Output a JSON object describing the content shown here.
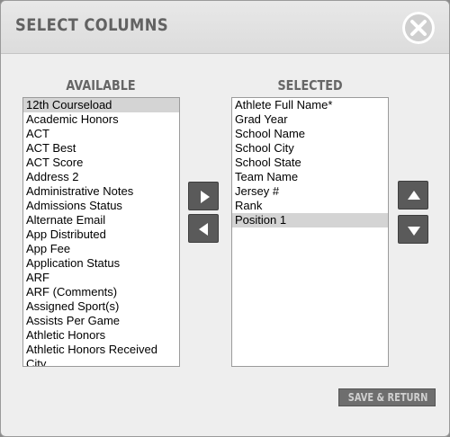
{
  "dialog": {
    "title": "SELECT COLUMNS",
    "close_icon": "close-x-icon"
  },
  "available": {
    "heading": "AVAILABLE",
    "items": [
      "12th Courseload",
      "Academic Honors",
      "ACT",
      "ACT Best",
      "ACT Score",
      "Address 2",
      "Administrative Notes",
      "Admissions Status",
      "Alternate Email",
      "App Distributed",
      "App Fee",
      "Application Status",
      "ARF",
      "ARF (Comments)",
      "Assigned Sport(s)",
      "Assists Per Game",
      "Athletic Honors",
      "Athletic Honors Received",
      "City"
    ],
    "selected_index": 0
  },
  "selected": {
    "heading": "SELECTED",
    "items": [
      "Athlete Full Name*",
      "Grad Year",
      "School Name",
      "School City",
      "School State",
      "Team Name",
      "Jersey #",
      "Rank",
      "Position 1"
    ],
    "selected_index": 8
  },
  "buttons": {
    "add_icon": "arrow-right-icon",
    "remove_icon": "arrow-left-icon",
    "move_up_icon": "arrow-up-icon",
    "move_down_icon": "arrow-down-icon",
    "save_label": "SAVE & RETURN"
  },
  "colors": {
    "dialog_bg": "#eeeeee",
    "button_bg": "#5a5a5a",
    "selection_bg": "#d4d4d4"
  }
}
